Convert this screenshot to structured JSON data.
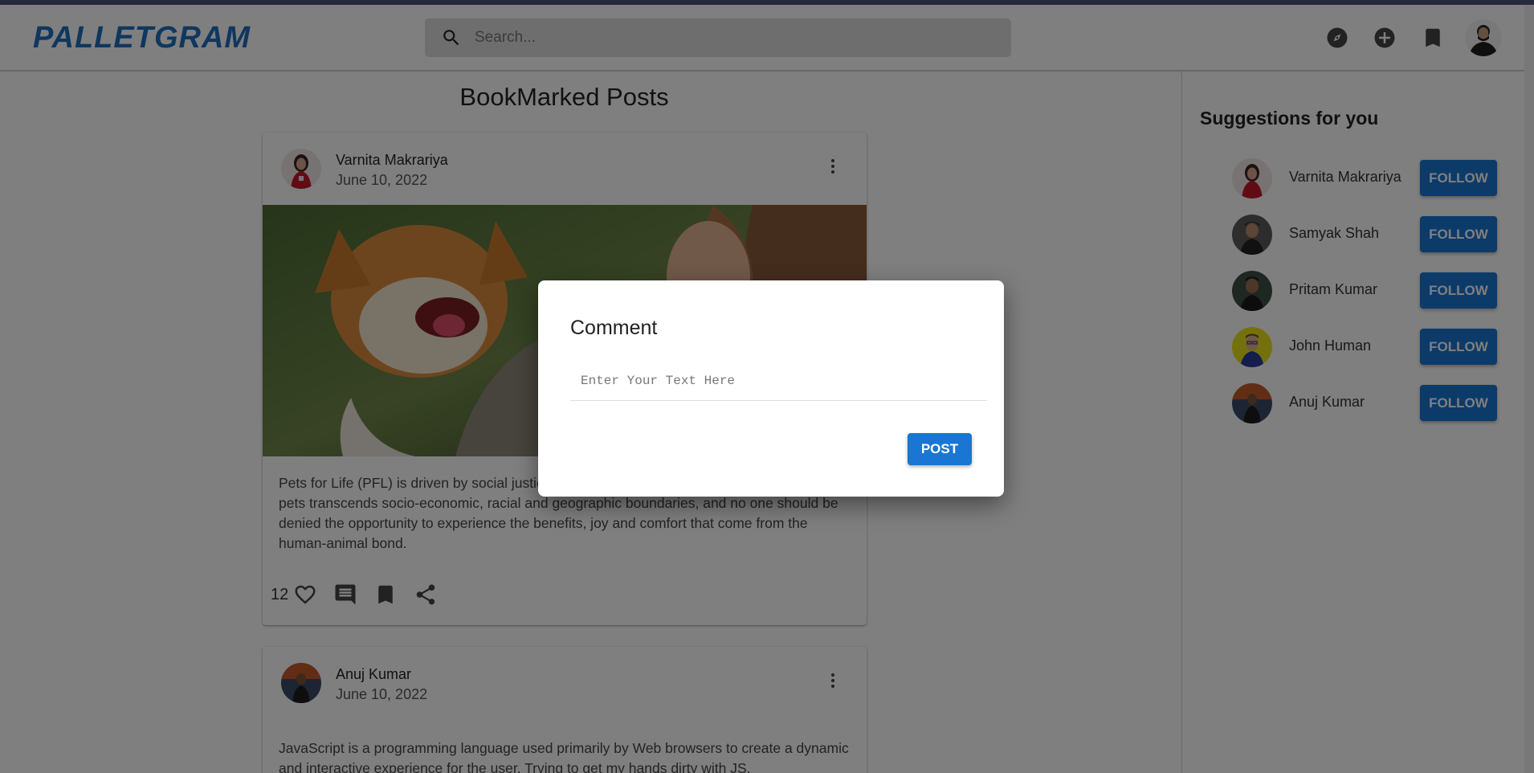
{
  "header": {
    "logo": "PALLETGRAM",
    "search_placeholder": "Search..."
  },
  "icons": {
    "search": "search-icon",
    "explore": "explore-compass-icon",
    "add": "add-circle-icon",
    "bookmark": "bookmark-icon",
    "profile": "profile-avatar"
  },
  "main": {
    "title": "BookMarked Posts",
    "posts": [
      {
        "author": "Varnita Makrariya",
        "date": "June 10, 2022",
        "text": "Pets for Life (PFL) is driven by social justice. We believe that the human connection with pets transcends socio-economic, racial and geographic boundaries, and no one should be denied the opportunity to experience the benefits, joy and comfort that come from the human-animal bond.",
        "likes": "12"
      },
      {
        "author": "Anuj Kumar",
        "date": "June 10, 2022",
        "text": "JavaScript is a programming language used primarily by Web browsers to create a dynamic and interactive experience for the user. Trying to get my hands dirty with JS."
      }
    ]
  },
  "sidebar": {
    "title": "Suggestions for you",
    "follow_label": "FOLLOW",
    "users": [
      {
        "name": "Varnita Makrariya"
      },
      {
        "name": "Samyak Shah"
      },
      {
        "name": "Pritam Kumar"
      },
      {
        "name": "John Human"
      },
      {
        "name": "Anuj Kumar"
      }
    ]
  },
  "dialog": {
    "title": "Comment",
    "placeholder": "Enter Your Text Here",
    "value": "",
    "post_label": "POST"
  },
  "colors": {
    "brand": "#1f6fbf",
    "button": "#1976d2",
    "overlay": "rgba(0,0,0,0.5)"
  }
}
